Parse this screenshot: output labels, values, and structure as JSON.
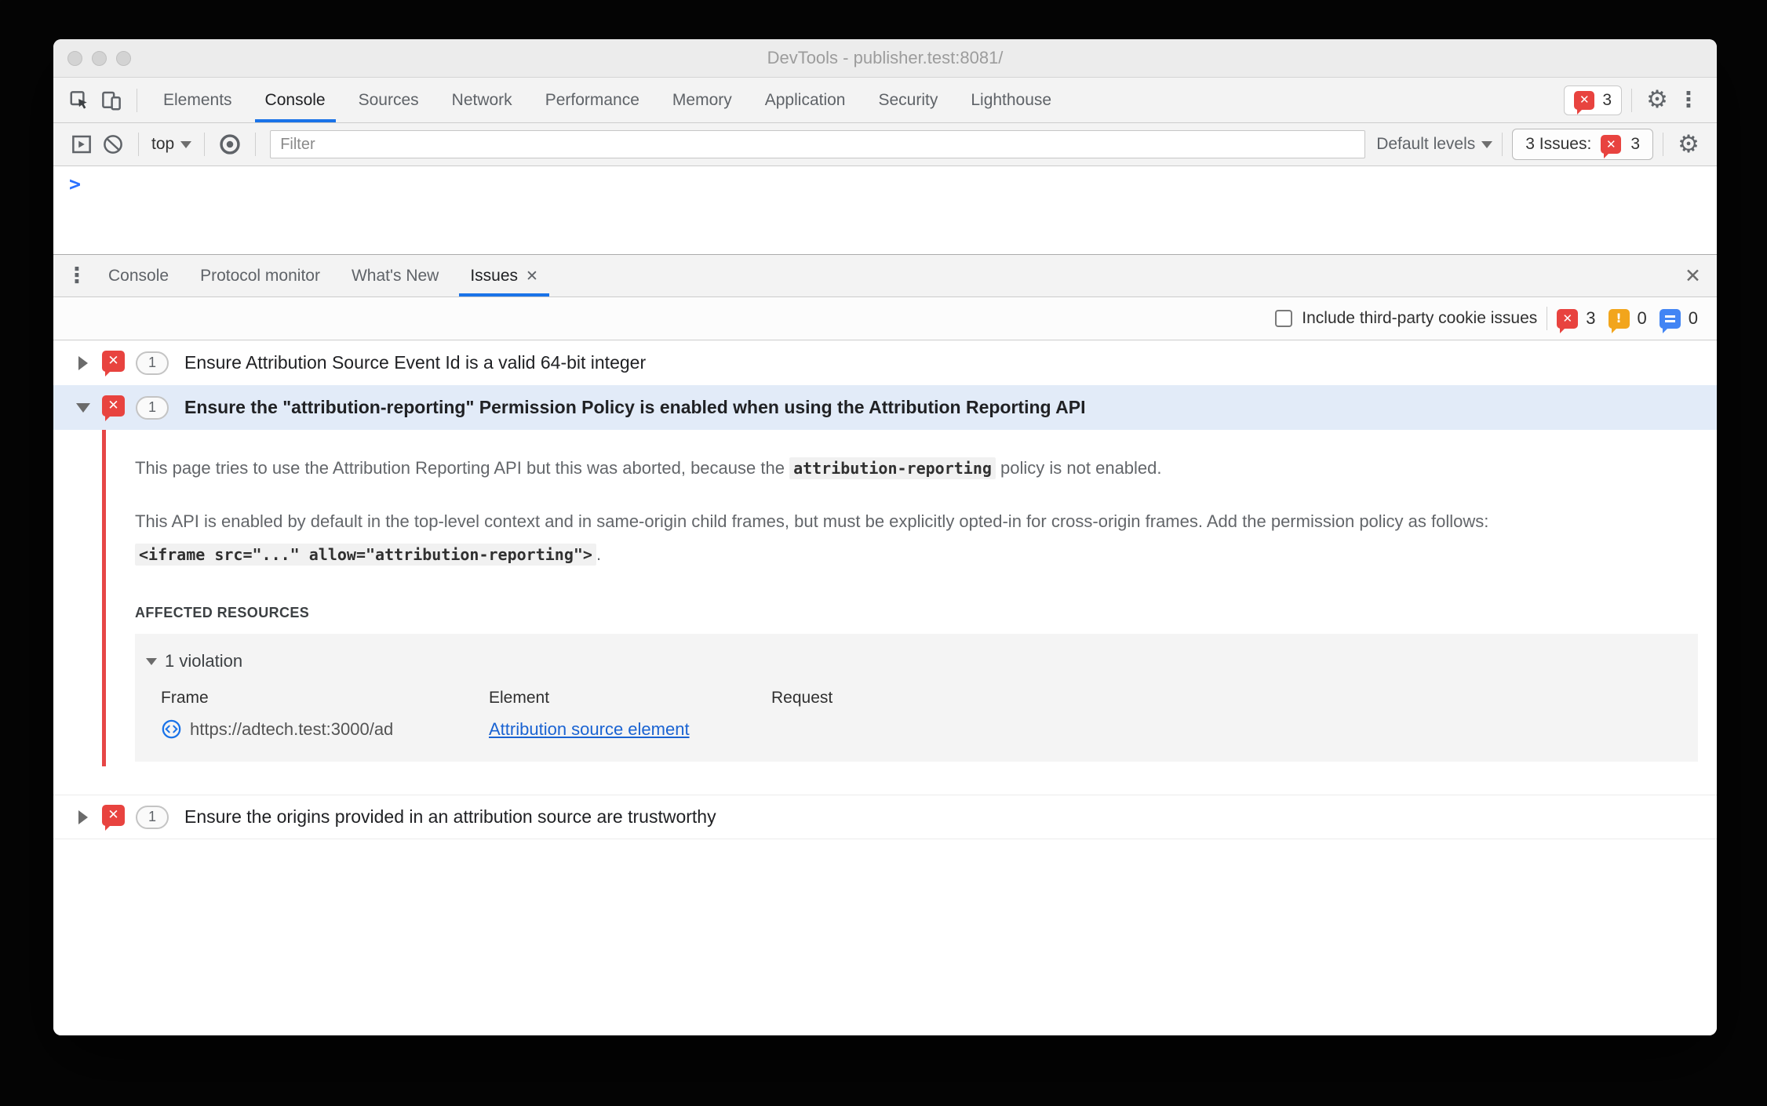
{
  "window": {
    "title": "DevTools - publisher.test:8081/"
  },
  "tabbar": {
    "tabs": [
      "Elements",
      "Console",
      "Sources",
      "Network",
      "Performance",
      "Memory",
      "Application",
      "Security",
      "Lighthouse"
    ],
    "active_tab": "Console",
    "error_count": "3"
  },
  "toolbar": {
    "context_label": "top",
    "filter_placeholder": "Filter",
    "levels_label": "Default levels",
    "issues_button_label": "3 Issues:",
    "issues_button_count": "3"
  },
  "console": {
    "prompt": ">"
  },
  "drawer": {
    "tabs": [
      "Console",
      "Protocol monitor",
      "What's New",
      "Issues"
    ],
    "active_tab": "Issues"
  },
  "issues_toolbar": {
    "checkbox_label": "Include third-party cookie issues",
    "error_count": "3",
    "warning_count": "0",
    "info_count": "0"
  },
  "issues": [
    {
      "count": "1",
      "title": "Ensure Attribution Source Event Id is a valid 64-bit integer"
    },
    {
      "count": "1",
      "title": "Ensure the \"attribution-reporting\" Permission Policy is enabled when using the Attribution Reporting API",
      "body": {
        "p1_before": "This page tries to use the Attribution Reporting API but this was aborted, because the ",
        "p1_code": "attribution-reporting",
        "p1_after": " policy is not enabled.",
        "p2_before": "This API is enabled by default in the top-level context and in same-origin child frames, but must be explicitly opted-in for cross-origin frames. Add the permission policy as follows: ",
        "p2_code": "<iframe src=\"...\" allow=\"attribution-reporting\">",
        "p2_after": ".",
        "affected_heading": "AFFECTED RESOURCES",
        "violations_label": "1 violation",
        "table": {
          "headers": [
            "Frame",
            "Element",
            "Request"
          ],
          "rows": [
            {
              "frame": "https://adtech.test:3000/ad",
              "element": "Attribution source element",
              "request": ""
            }
          ]
        }
      }
    },
    {
      "count": "1",
      "title": "Ensure the origins provided in an attribution source are trustworthy"
    }
  ],
  "icons": {
    "gear": "⚙",
    "kebab": "⋮",
    "close": "✕",
    "tab_close": "✕",
    "bubble_x": "✕",
    "bubble_exclaim": "!"
  },
  "colors": {
    "accent_blue": "#1a73e8",
    "error_red": "#e8433f",
    "warning_orange": "#f2a51c",
    "info_blue": "#4285f4",
    "selected_row": "#e2ebf8",
    "issue_line_red": "#e64646",
    "link_blue": "#1a63d2"
  }
}
